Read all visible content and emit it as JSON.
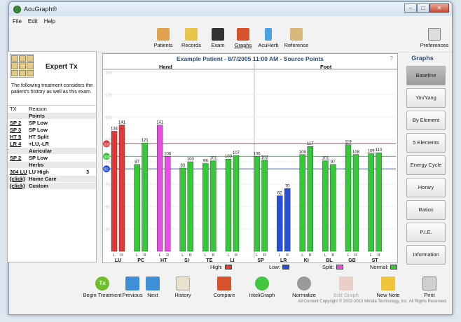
{
  "window": {
    "title": "AcuGraph®"
  },
  "menu": [
    "File",
    "Edit",
    "Help"
  ],
  "toolbar": {
    "items": [
      {
        "label": "Patients",
        "icon": "patients-icon",
        "color": "#e0a24c"
      },
      {
        "label": "Records",
        "icon": "records-icon",
        "color": "#e8c64a"
      },
      {
        "label": "Exam",
        "icon": "exam-icon",
        "color": "#333333"
      },
      {
        "label": "Graphs",
        "icon": "graphs-icon",
        "color": "#d8522b"
      },
      {
        "label": "AcuHerb",
        "icon": "acuherb-icon",
        "color": "#4aa3e0"
      },
      {
        "label": "Reference",
        "icon": "reference-icon",
        "color": "#d9b77a"
      }
    ],
    "preferences": "Preferences"
  },
  "expert": {
    "title": "Expert Tx",
    "description": "The following treatment considers the patient's history as well as this exam.",
    "headers": {
      "tx": "TX",
      "reason": "Reason"
    },
    "rows": [
      {
        "tx": "",
        "reason": "Points",
        "n": ""
      },
      {
        "tx": "SP 2",
        "reason": "SP Low",
        "n": ""
      },
      {
        "tx": "SP 3",
        "reason": "SP Low",
        "n": ""
      },
      {
        "tx": "HT 5",
        "reason": "HT Split",
        "n": ""
      },
      {
        "tx": "LR 4",
        "reason": "+LU,-LR",
        "n": ""
      },
      {
        "tx": "",
        "reason": "Auricular",
        "n": ""
      },
      {
        "tx": "SP 2",
        "reason": "SP Low",
        "n": ""
      },
      {
        "tx": "",
        "reason": "Herbs",
        "n": ""
      },
      {
        "tx": "304 LU",
        "reason": "LU High",
        "n": "3"
      },
      {
        "tx": "(click)",
        "reason": "Home Care",
        "n": ""
      },
      {
        "tx": "(click)",
        "reason": "Custom",
        "n": ""
      }
    ]
  },
  "chart_panel": {
    "help": "?"
  },
  "chart_data": {
    "type": "bar",
    "title": "Example Patient - 8/7/2005 11:00 AM - Source Points",
    "sections": [
      "Hand",
      "Foot"
    ],
    "categories": [
      "LU",
      "PC",
      "HT",
      "SI",
      "TE",
      "LI",
      "SP",
      "LR",
      "KI",
      "BL",
      "GB",
      "ST"
    ],
    "sides": [
      "L",
      "R"
    ],
    "values": [
      [
        134,
        141
      ],
      [
        97,
        121
      ],
      [
        141,
        106
      ],
      [
        93,
        100
      ],
      [
        98,
        101
      ],
      [
        103,
        107
      ],
      [
        106,
        102
      ],
      [
        62,
        70
      ],
      [
        108,
        117
      ],
      [
        101,
        97
      ],
      [
        119,
        108
      ],
      [
        109,
        110
      ]
    ],
    "bar_colors": [
      [
        "red",
        "red"
      ],
      [
        "green",
        "green"
      ],
      [
        "magenta",
        "magenta"
      ],
      [
        "green",
        "green"
      ],
      [
        "green",
        "green"
      ],
      [
        "green",
        "green"
      ],
      [
        "green",
        "green"
      ],
      [
        "blue",
        "blue"
      ],
      [
        "green",
        "green"
      ],
      [
        "green",
        "green"
      ],
      [
        "green",
        "green"
      ],
      [
        "green",
        "green"
      ]
    ],
    "colors": {
      "red": "#e0393a",
      "green": "#35c93a",
      "magenta": "#e84ee0",
      "blue": "#2650d8"
    },
    "yticks": [
      200,
      175,
      150,
      125,
      100,
      75,
      50,
      25
    ],
    "ylim": [
      0,
      200
    ],
    "thresholds": {
      "high": 120,
      "mean": 106,
      "low": 92
    },
    "threshold_colors": {
      "high": "#e0393a",
      "mean": "#35c93a",
      "low": "#2650d8"
    }
  },
  "graphs": {
    "title": "Graphs",
    "buttons": [
      "Baseline",
      "Yin/Yang",
      "By Element",
      "5 Elements",
      "Energy Cycle",
      "Horary",
      "Ratios",
      "P.I.E.",
      "Information"
    ]
  },
  "legend": [
    {
      "label": "High:",
      "color": "#e0393a"
    },
    {
      "label": "Low:",
      "color": "#2650d8"
    },
    {
      "label": "Split:",
      "color": "#e84ee0"
    },
    {
      "label": "Normal:",
      "color": "#35c93a"
    }
  ],
  "bottom": {
    "begin_treatment": "Begin Treatment",
    "begin_treatment_icon_text": "Tx",
    "previous": "Previous",
    "next": "Next",
    "history": "History",
    "compare": "Compare",
    "inteligraph": "InteliGraph",
    "normalize": "Normalize",
    "edit_graph": "Edit Graph",
    "new_note": "New Note",
    "print": "Print",
    "copyright": "All Content Copyright © 2002-2010 Miridia Technology, Inc.  All Rights Reserved."
  }
}
